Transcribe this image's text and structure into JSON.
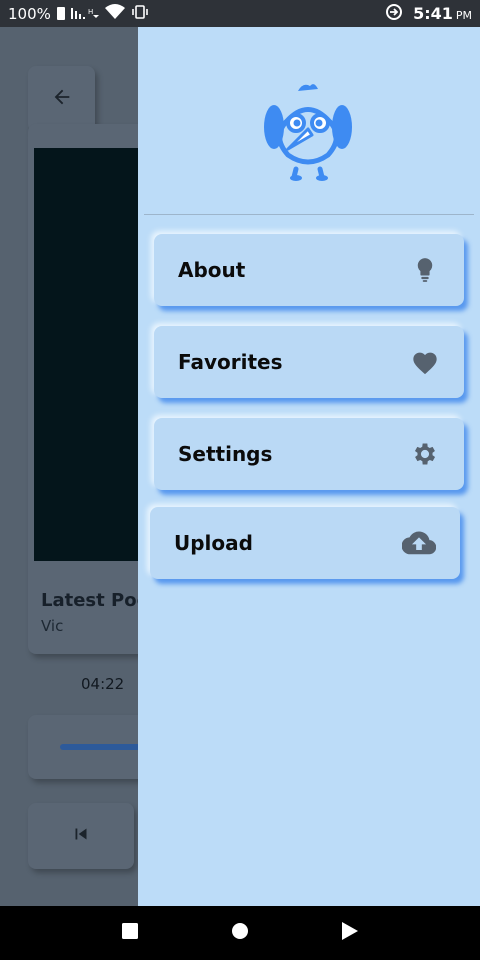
{
  "status_bar": {
    "battery": "100%",
    "time": "5:41",
    "ampm": "PM",
    "icons": [
      "battery-icon",
      "signal-icon",
      "wifi-icon",
      "vibrate-icon",
      "data-saver-icon"
    ]
  },
  "background_player": {
    "podcast_title": "Latest Pod",
    "author": "Vic",
    "elapsed": "04:22"
  },
  "drawer": {
    "logo_icon": "owl-bird-logo",
    "items": [
      {
        "label": "About",
        "icon": "lightbulb-icon"
      },
      {
        "label": "Favorites",
        "icon": "heart-icon"
      },
      {
        "label": "Settings",
        "icon": "gear-icon"
      },
      {
        "label": "Upload",
        "icon": "cloud-upload-icon"
      }
    ]
  },
  "colors": {
    "drawer_bg": "#bcdcf8",
    "accent": "#3e8bf2",
    "icon_gray": "#56626f"
  }
}
